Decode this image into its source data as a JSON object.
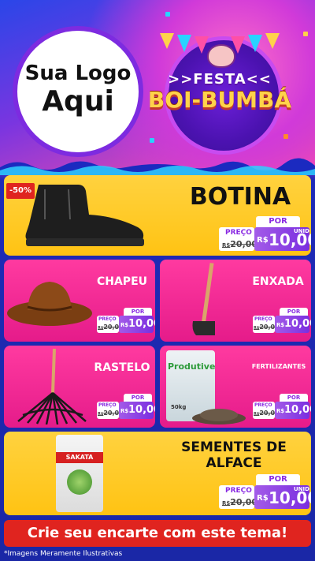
{
  "header": {
    "logo_line1": "Sua Logo",
    "logo_line2": "Aqui",
    "festa_title": ">>FESTA<<",
    "festa_sub": "BOI-BUMBÁ"
  },
  "featured": {
    "name": "BOTINA",
    "discount": "-50%",
    "por_label": "POR",
    "preco_label": "PREÇO",
    "old_price": "R$20,00",
    "old_prefix": "R$",
    "old_value": "20,00",
    "currency": "R$",
    "new_value": "10,00",
    "unit": "UNID"
  },
  "products": [
    {
      "name": "CHAPEU",
      "por_label": "POR",
      "preco_label": "PREÇO",
      "old_prefix": "R$",
      "old_value": "20,00",
      "currency": "R$",
      "new_value": "10,00"
    },
    {
      "name": "ENXADA",
      "por_label": "POR",
      "preco_label": "PREÇO",
      "old_prefix": "R$",
      "old_value": "20,00",
      "currency": "R$",
      "new_value": "10,00"
    },
    {
      "name": "RASTELO",
      "por_label": "POR",
      "preco_label": "PREÇO",
      "old_prefix": "R$",
      "old_value": "20,00",
      "currency": "R$",
      "new_value": "10,00"
    },
    {
      "name": "FERTILIZANTES",
      "por_label": "POR",
      "preco_label": "PREÇO",
      "old_prefix": "R$",
      "old_value": "20,00",
      "currency": "R$",
      "new_value": "10,00",
      "bag_brand": "Produtive",
      "bag_weight": "50kg"
    }
  ],
  "seeds": {
    "name_line1": "SEMENTES DE",
    "name_line2": "ALFACE",
    "brand": "SAKATA",
    "por_label": "POR",
    "preco_label": "PREÇO",
    "old_prefix": "R$",
    "old_value": "20,00",
    "currency": "R$",
    "new_value": "10,00",
    "unit": "UNID"
  },
  "footer": {
    "cta": "Crie seu encarte com este tema!",
    "disclaimer": "*Imagens Meramente Ilustrativas"
  },
  "colors": {
    "yellow": "#ffc313",
    "pink": "#e51b8a",
    "purple": "#8a2be2",
    "red": "#e0241f"
  }
}
